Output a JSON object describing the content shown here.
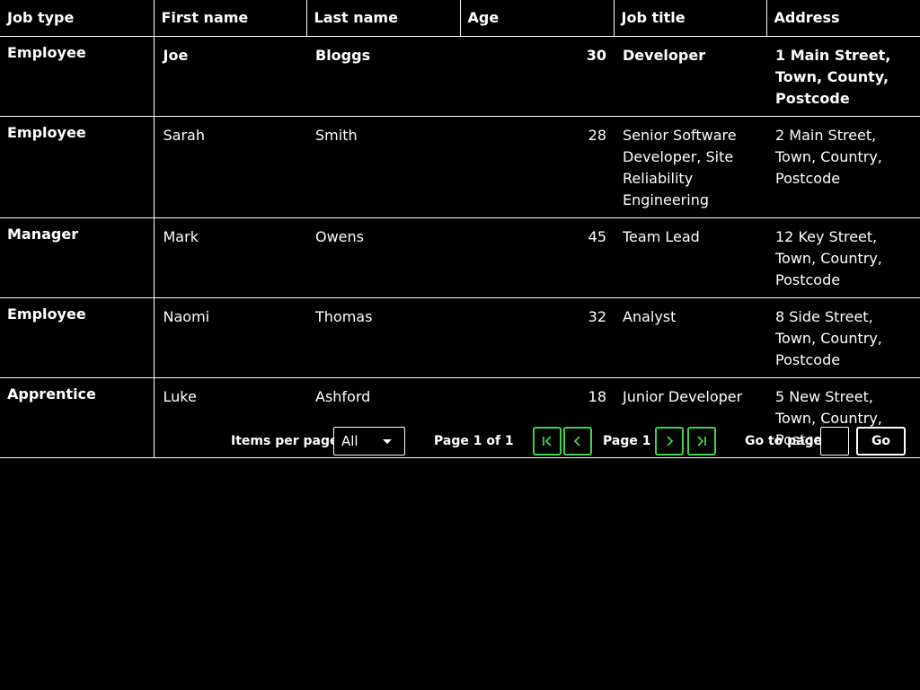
{
  "table": {
    "headers": [
      "Job type",
      "First name",
      "Last name",
      "Age",
      "Job title",
      "Address"
    ],
    "rows": [
      {
        "job_type": "Employee",
        "first": "Joe",
        "last": "Bloggs",
        "age": "30",
        "title": "Developer",
        "address": "1 Main Street, Town, County, Postcode",
        "bold": true
      },
      {
        "job_type": "Employee",
        "first": "Sarah",
        "last": "Smith",
        "age": "28",
        "title": "Senior Software Developer, Site Reliability Engineering",
        "address": "2 Main Street, Town, Country, Postcode",
        "bold": false
      },
      {
        "job_type": "Manager",
        "first": "Mark",
        "last": "Owens",
        "age": "45",
        "title": "Team Lead",
        "address": "12 Key Street, Town, Country, Postcode",
        "bold": false
      },
      {
        "job_type": "Employee",
        "first": "Naomi",
        "last": "Thomas",
        "age": "32",
        "title": "Analyst",
        "address": "8 Side Street, Town, Country, Postcode",
        "bold": false
      },
      {
        "job_type": "Apprentice",
        "first": "Luke",
        "last": "Ashford",
        "age": "18",
        "title": "Junior Developer",
        "address": "5 New Street, Town, Country, Postcode",
        "bold": false
      }
    ]
  },
  "pagination": {
    "items_per_page_label": "Items per page",
    "items_per_page_value": "All",
    "page_info": "Page 1 of 1",
    "current_page": "Page 1",
    "go_to_page_label": "Go to page",
    "go_input_value": "",
    "go_button": "Go",
    "icons": {
      "first": "first-page-icon",
      "prev": "previous-page-icon",
      "next": "next-page-icon",
      "last": "last-page-icon"
    },
    "accent_color": "#3fd34a"
  }
}
